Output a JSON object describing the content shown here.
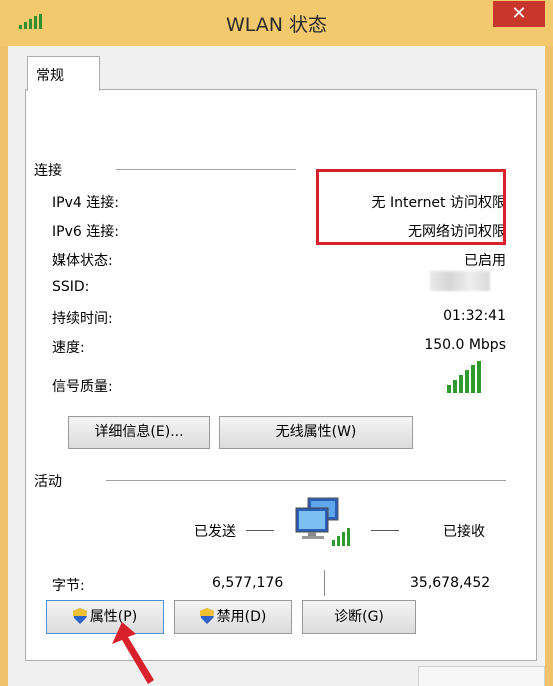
{
  "window": {
    "title": "WLAN 状态",
    "close_symbol": "✕"
  },
  "tabs": [
    {
      "label": "常规"
    }
  ],
  "connection": {
    "section_title": "连接",
    "rows": [
      {
        "label": "IPv4 连接:",
        "value": "无 Internet 访问权限"
      },
      {
        "label": "IPv6 连接:",
        "value": "无网络访问权限"
      },
      {
        "label": "媒体状态:",
        "value": "已启用"
      },
      {
        "label": "SSID:",
        "value": ""
      },
      {
        "label": "持续时间:",
        "value": "01:32:41"
      },
      {
        "label": "速度:",
        "value": "150.0 Mbps"
      },
      {
        "label": "信号质量:",
        "value": ""
      }
    ],
    "signal_icon": "signal-strength-icon",
    "buttons": {
      "details": "详细信息(E)...",
      "wireless_props": "无线属性(W)"
    }
  },
  "activity": {
    "section_title": "活动",
    "sent_label": "已发送",
    "received_label": "已接收",
    "bytes_label": "字节:",
    "bytes_sent": "6,577,176",
    "bytes_received": "35,678,452",
    "network_icon": "network-computers-icon"
  },
  "bottom_buttons": {
    "properties": "属性(P)",
    "disable": "禁用(D)",
    "diagnose": "诊断(G)"
  },
  "colors": {
    "titlebar": "#f3c96e",
    "close": "#c9362b",
    "highlight": "#d8212a",
    "signal": "#2f9b2f"
  }
}
